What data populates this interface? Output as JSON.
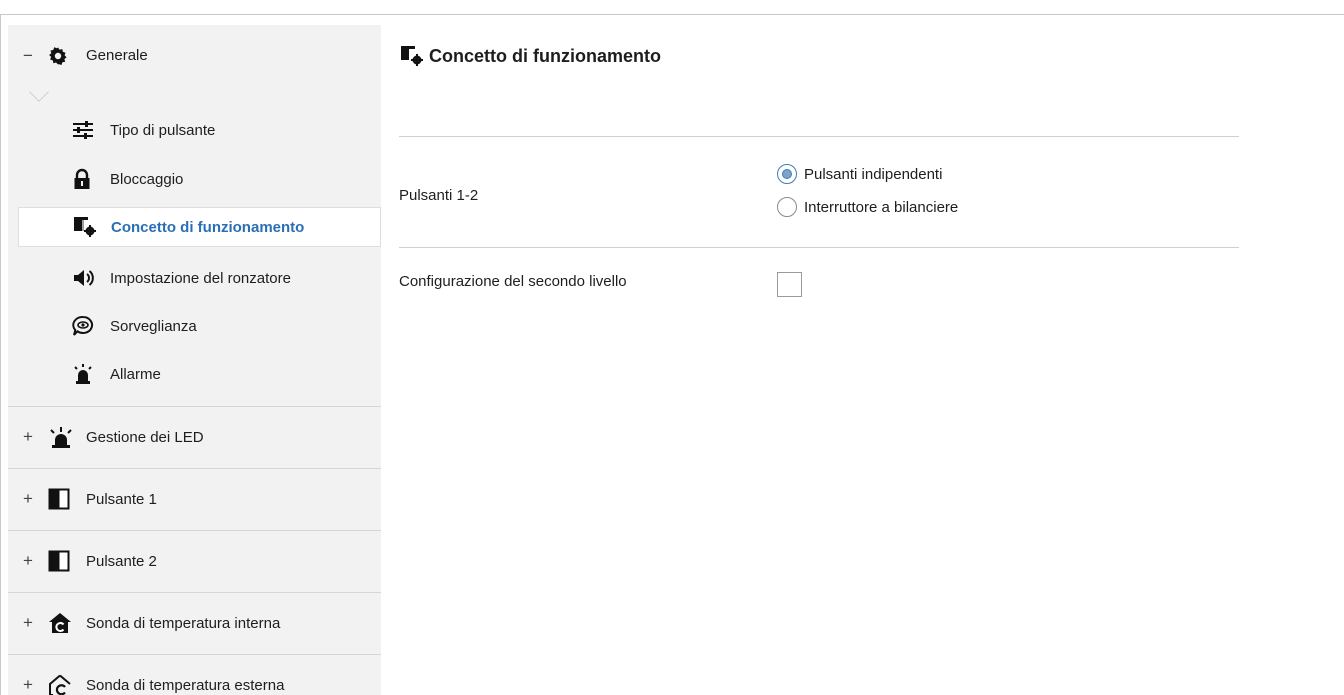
{
  "sidebar": {
    "generale": {
      "toggle": "−",
      "label": "Generale",
      "icon": "gear-icon"
    },
    "items": [
      {
        "label": "Tipo di pulsante",
        "icon": "sliders-icon"
      },
      {
        "label": "Bloccaggio",
        "icon": "lock-icon"
      },
      {
        "label": "Concetto di funzionamento",
        "icon": "concept-gear-icon",
        "active": true
      },
      {
        "label": "Impostazione del ronzatore",
        "icon": "speaker-icon"
      },
      {
        "label": "Sorveglianza",
        "icon": "eye-bubble-icon"
      },
      {
        "label": "Allarme",
        "icon": "alarm-bell-icon"
      }
    ],
    "groups": [
      {
        "toggle": "+",
        "label": "Gestione dei LED",
        "icon": "led-icon"
      },
      {
        "toggle": "+",
        "label": "Pulsante 1",
        "icon": "button-half-icon"
      },
      {
        "toggle": "+",
        "label": "Pulsante 2",
        "icon": "button-half-icon"
      },
      {
        "toggle": "+",
        "label": "Sonda di temperatura interna",
        "icon": "house-temp-icon"
      },
      {
        "toggle": "+",
        "label": "Sonda di temperatura esterna",
        "icon": "house-temp-outline-icon"
      }
    ]
  },
  "main": {
    "title": "Concetto di funzionamento",
    "pulsanti": {
      "label": "Pulsanti 1-2",
      "options": [
        {
          "label": "Pulsanti indipendenti",
          "checked": true
        },
        {
          "label": "Interruttore a bilanciere",
          "checked": false
        }
      ]
    },
    "secondo_livello": {
      "label": "Configurazione del secondo livello",
      "checked": false
    }
  },
  "colors": {
    "accent": "#2a6fb5",
    "sidebar_bg": "#f2f2f2"
  }
}
